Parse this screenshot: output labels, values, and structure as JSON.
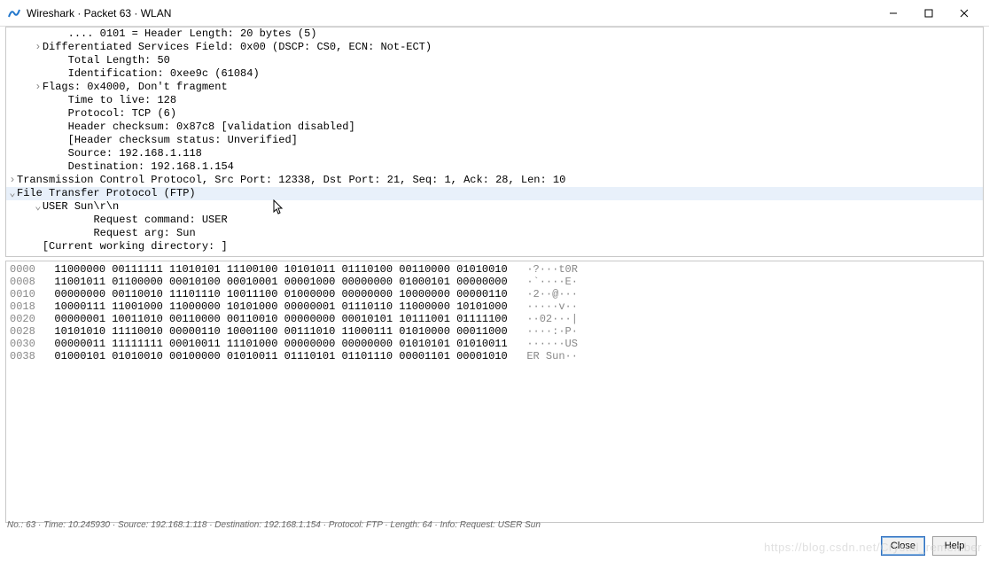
{
  "window": {
    "title": "Wireshark · Packet 63 · WLAN"
  },
  "tree": {
    "lines": [
      {
        "indent": 3,
        "arrow": "",
        "text": ".... 0101 = Header Length: 20 bytes (5)"
      },
      {
        "indent": 2,
        "arrow": "closed",
        "text": "Differentiated Services Field: 0x00 (DSCP: CS0, ECN: Not-ECT)"
      },
      {
        "indent": 3,
        "arrow": "",
        "text": "Total Length: 50"
      },
      {
        "indent": 3,
        "arrow": "",
        "text": "Identification: 0xee9c (61084)"
      },
      {
        "indent": 2,
        "arrow": "closed",
        "text": "Flags: 0x4000, Don't fragment"
      },
      {
        "indent": 3,
        "arrow": "",
        "text": "Time to live: 128"
      },
      {
        "indent": 3,
        "arrow": "",
        "text": "Protocol: TCP (6)"
      },
      {
        "indent": 3,
        "arrow": "",
        "text": "Header checksum: 0x87c8 [validation disabled]"
      },
      {
        "indent": 3,
        "arrow": "",
        "text": "[Header checksum status: Unverified]"
      },
      {
        "indent": 3,
        "arrow": "",
        "text": "Source: 192.168.1.118"
      },
      {
        "indent": 3,
        "arrow": "",
        "text": "Destination: 192.168.1.154"
      },
      {
        "indent": 1,
        "arrow": "closed",
        "text": "Transmission Control Protocol, Src Port: 12338, Dst Port: 21, Seq: 1, Ack: 28, Len: 10"
      },
      {
        "indent": 1,
        "arrow": "open",
        "text": "File Transfer Protocol (FTP)",
        "highlight": true
      },
      {
        "indent": 2,
        "arrow": "open",
        "text": "USER Sun\\r\\n"
      },
      {
        "indent": 4,
        "arrow": "",
        "text": "Request command: USER"
      },
      {
        "indent": 4,
        "arrow": "",
        "text": "Request arg: Sun"
      },
      {
        "indent": 2,
        "arrow": "",
        "text": "[Current working directory: ]"
      }
    ]
  },
  "hex": {
    "rows": [
      {
        "offset": "0000",
        "bytes": "11000000 00111111 11010101 11100100 10101011 01110100 00110000 01010010",
        "ascii": "·?···t0R"
      },
      {
        "offset": "0008",
        "bytes": "11001011 01100000 00010100 00010001 00001000 00000000 01000101 00000000",
        "ascii": "·`····E·"
      },
      {
        "offset": "0010",
        "bytes": "00000000 00110010 11101110 10011100 01000000 00000000 10000000 00000110",
        "ascii": "·2··@···"
      },
      {
        "offset": "0018",
        "bytes": "10000111 11001000 11000000 10101000 00000001 01110110 11000000 10101000",
        "ascii": "·····v··"
      },
      {
        "offset": "0020",
        "bytes": "00000001 10011010 00110000 00110010 00000000 00010101 10111001 01111100",
        "ascii": "··02···|"
      },
      {
        "offset": "0028",
        "bytes": "10101010 11110010 00000110 10001100 00111010 11000111 01010000 00011000",
        "ascii": "····:·P·"
      },
      {
        "offset": "0030",
        "bytes": "00000011 11111111 00010011 11101000 00000000 00000000 01010101 01010011",
        "ascii": "······US"
      },
      {
        "offset": "0038",
        "bytes": "01000101 01010010 00100000 01010011 01110101 01101110 00001101 00001010",
        "ascii": "ER Sun··"
      }
    ]
  },
  "status": {
    "text": "No.: 63  ·  Time: 10.245930  ·  Source: 192.168.1.118  ·  Destination: 192.168.1.154  ·  Protocol: FTP  ·  Length: 64  ·  Info: Request: USER Sun"
  },
  "buttons": {
    "close": "Close",
    "help": "Help"
  },
  "watermark": "https://blog.csdn.net/Crystal_remember"
}
